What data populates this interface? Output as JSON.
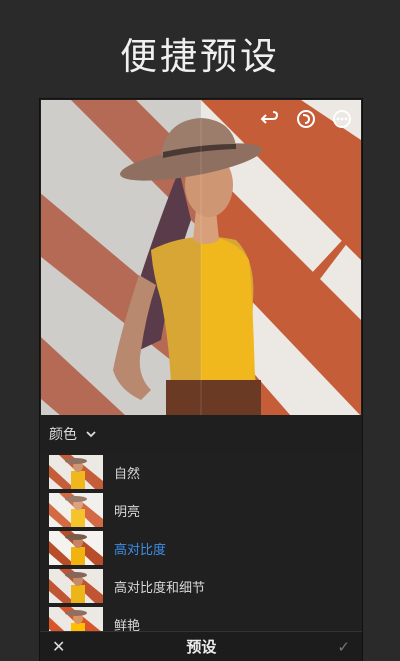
{
  "headline": "便捷预设",
  "photo": {
    "icons": [
      "undo-icon",
      "presets-icon",
      "more-icon"
    ]
  },
  "category": {
    "label": "颜色"
  },
  "presets": [
    {
      "label": "自然"
    },
    {
      "label": "明亮"
    },
    {
      "label": "高对比度"
    },
    {
      "label": "高对比度和细节"
    },
    {
      "label": "鲜艳"
    }
  ],
  "selected_preset_index": 2,
  "bottom": {
    "title": "预设",
    "cancel": "✕",
    "confirm": "✓"
  },
  "colors": {
    "accent": "#3d8fe8",
    "stripe_orange": "#c65f3c",
    "stripe_light": "#e8e6e2",
    "shirt": "#e8b526"
  }
}
